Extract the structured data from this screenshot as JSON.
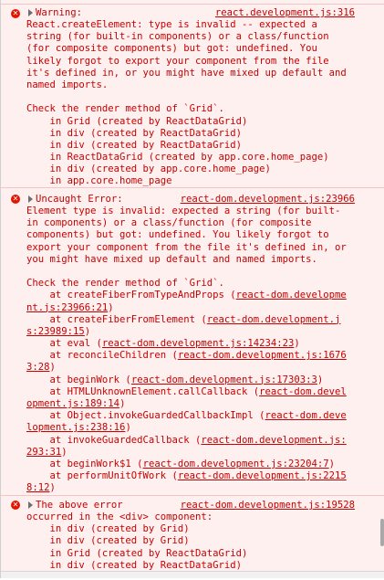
{
  "messages": [
    {
      "label": "Warning:",
      "source": "react.development.js:316",
      "lines": [
        "React.createElement: type is invalid -- expected a",
        "string (for built-in components) or a class/function",
        "(for composite components) but got: undefined. You",
        "likely forgot to export your component from the file",
        "it's defined in, or you might have mixed up default and",
        "named imports.",
        "",
        "Check the render method of `Grid`.",
        "    in Grid (created by ReactDataGrid)",
        "    in div (created by ReactDataGrid)",
        "    in div (created by ReactDataGrid)",
        "    in ReactDataGrid (created by app.core.home_page)",
        "    in div (created by app.core.home_page)",
        "    in app.core.home_page"
      ]
    },
    {
      "label": "Uncaught Error:",
      "source": "react-dom.development.js:23966",
      "lines": [
        "Element type is invalid: expected a string (for built-",
        "in components) or a class/function (for composite",
        "components) but got: undefined. You likely forgot to",
        "export your component from the file it's defined in, or",
        "you might have mixed up default and named imports.",
        "",
        "Check the render method of `Grid`."
      ],
      "stack": [
        {
          "pre": "    at createFiberFromTypeAndProps (",
          "link1": "react-dom.developme",
          "link2": "nt.js:23966:21",
          "post": ")"
        },
        {
          "pre": "    at createFiberFromElement (",
          "link1": "react-dom.development.j",
          "link2": "s:23989:15",
          "post": ")"
        },
        {
          "pre": "    at eval (",
          "link1": "react-dom.development.js:14234:23",
          "link2": "",
          "post": ")"
        },
        {
          "pre": "    at reconcileChildren (",
          "link1": "react-dom.development.js:1676",
          "link2": "3:28",
          "post": ")"
        },
        {
          "pre": "    at beginWork (",
          "link1": "react-dom.development.js:17303:3",
          "link2": "",
          "post": ")"
        },
        {
          "pre": "    at HTMLUnknownElement.callCallback (",
          "link1": "react-dom.devel",
          "link2": "opment.js:189:14",
          "post": ")"
        },
        {
          "pre": "    at Object.invokeGuardedCallbackImpl (",
          "link1": "react-dom.deve",
          "link2": "lopment.js:238:16",
          "post": ")"
        },
        {
          "pre": "    at invokeGuardedCallback (",
          "link1": "react-dom.development.js:",
          "link2": "293:31",
          "post": ")"
        },
        {
          "pre": "    at beginWork$1 (",
          "link1": "react-dom.development.js:23204:7",
          "link2": "",
          "post": ")"
        },
        {
          "pre": "    at performUnitOfWork (",
          "link1": "react-dom.development.js:2215",
          "link2": "8:12",
          "post": ")"
        }
      ]
    },
    {
      "label": "The above error",
      "source": "react-dom.development.js:19528",
      "lines": [
        "occurred in the <div> component:",
        "    in div (created by Grid)",
        "    in div (created by Grid)",
        "    in Grid (created by ReactDataGrid)",
        "    in div (created by ReactDataGrid)"
      ]
    }
  ],
  "colors": {
    "error_text": "#c80000",
    "error_bg": "#fff0f0",
    "error_icon": "#e51400"
  },
  "icons": {
    "error": "error-circle-icon",
    "expand": "expand-triangle-icon"
  }
}
